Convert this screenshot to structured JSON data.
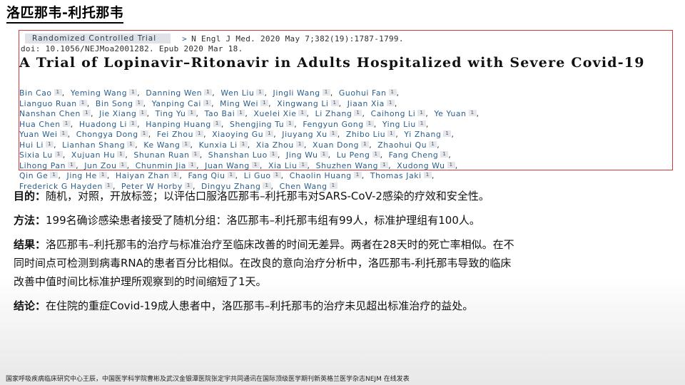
{
  "slide": {
    "title": "洛匹那韦-利托那韦",
    "footer": "国家呼吸疾病临床研究中心王辰，中国医学科学院曹彬及武汉金银潭医院张定宇共同通讯在国际顶级医学期刊新英格兰医学杂志NEJM 在线发表"
  },
  "paper": {
    "tag": "Randomized Controlled Trial",
    "journal_ref": "N Engl J Med. 2020 May 7;382(19):1787-1799.",
    "doi_line": "doi: 10.1056/NEJMoa2001282. Epub 2020 Mar 18.",
    "title": "A Trial of Lopinavir–Ritonavir in Adults Hospitalized with Severe Covid-19",
    "affiliation_mark": "1",
    "authors": [
      "Bin Cao",
      "Yeming Wang",
      "Danning Wen",
      "Wen Liu",
      "Jingli Wang",
      "Guohui Fan",
      "Lianguo Ruan",
      "Bin Song",
      "Yanping Cai",
      "Ming Wei",
      "Xingwang Li",
      "Jiaan Xia",
      "Nanshan Chen",
      "Jie Xiang",
      "Ting Yu",
      "Tao Bai",
      "Xuelei Xie",
      "Li Zhang",
      "Caihong Li",
      "Ye Yuan",
      "Hua Chen",
      "Huadong Li",
      "Hanping Huang",
      "Shengjing Tu",
      "Fengyun Gong",
      "Ying Liu",
      "Yuan Wei",
      "Chongya Dong",
      "Fei Zhou",
      "Xiaoying Gu",
      "Jiuyang Xu",
      "Zhibo Liu",
      "Yi Zhang",
      "Hui Li",
      "Lianhan Shang",
      "Ke Wang",
      "Kunxia Li",
      "Xia Zhou",
      "Xuan Dong",
      "Zhaohui Qu",
      "Sixia Lu",
      "Xujuan Hu",
      "Shunan Ruan",
      "Shanshan Luo",
      "Jing Wu",
      "Lu Peng",
      "Fang Cheng",
      "Lihong Pan",
      "Jun Zou",
      "Chunmin Jia",
      "Juan Wang",
      "Xia Liu",
      "Shuzhen Wang",
      "Xudong Wu",
      "Qin Ge",
      "Jing He",
      "Haiyan Zhan",
      "Fang Qiu",
      "Li Guo",
      "Chaolin Huang",
      "Thomas Jaki",
      "Frederick G Hayden",
      "Peter W Horby",
      "Dingyu Zhang",
      "Chen Wang"
    ],
    "author_line_breaks": [
      6,
      12,
      20,
      26,
      33,
      40,
      47,
      54,
      61
    ]
  },
  "summary": {
    "objective_label": "目的：",
    "objective_text": "随机，对照，开放标签；以评估口服洛匹那韦–利托那韦对SARS-CoV-2感染的疗效和安全性。",
    "methods_label": "方法：",
    "methods_text": "199名确诊感染患者接受了随机分组：洛匹那韦–利托那韦组有99人，标准护理组有100人。",
    "results_label": "结果：",
    "results_line1": "洛匹那韦–利托那韦的治疗与标准治疗至临床改善的时间无差异。两者在28天时的死亡率相似。在不",
    "results_line2": "同时间点可检测到病毒RNA的患者百分比相似。在改良的意向治疗分析中，洛匹那韦-利托那韦导致的临床",
    "results_line3": "改善中值时间比标准护理所观察到的时间缩短了1天。",
    "conclusion_label": "结论：",
    "conclusion_text": "在住院的重症Covid-19成人患者中，洛匹那韦–利托那韦的治疗未见超出标准治疗的益处。"
  }
}
